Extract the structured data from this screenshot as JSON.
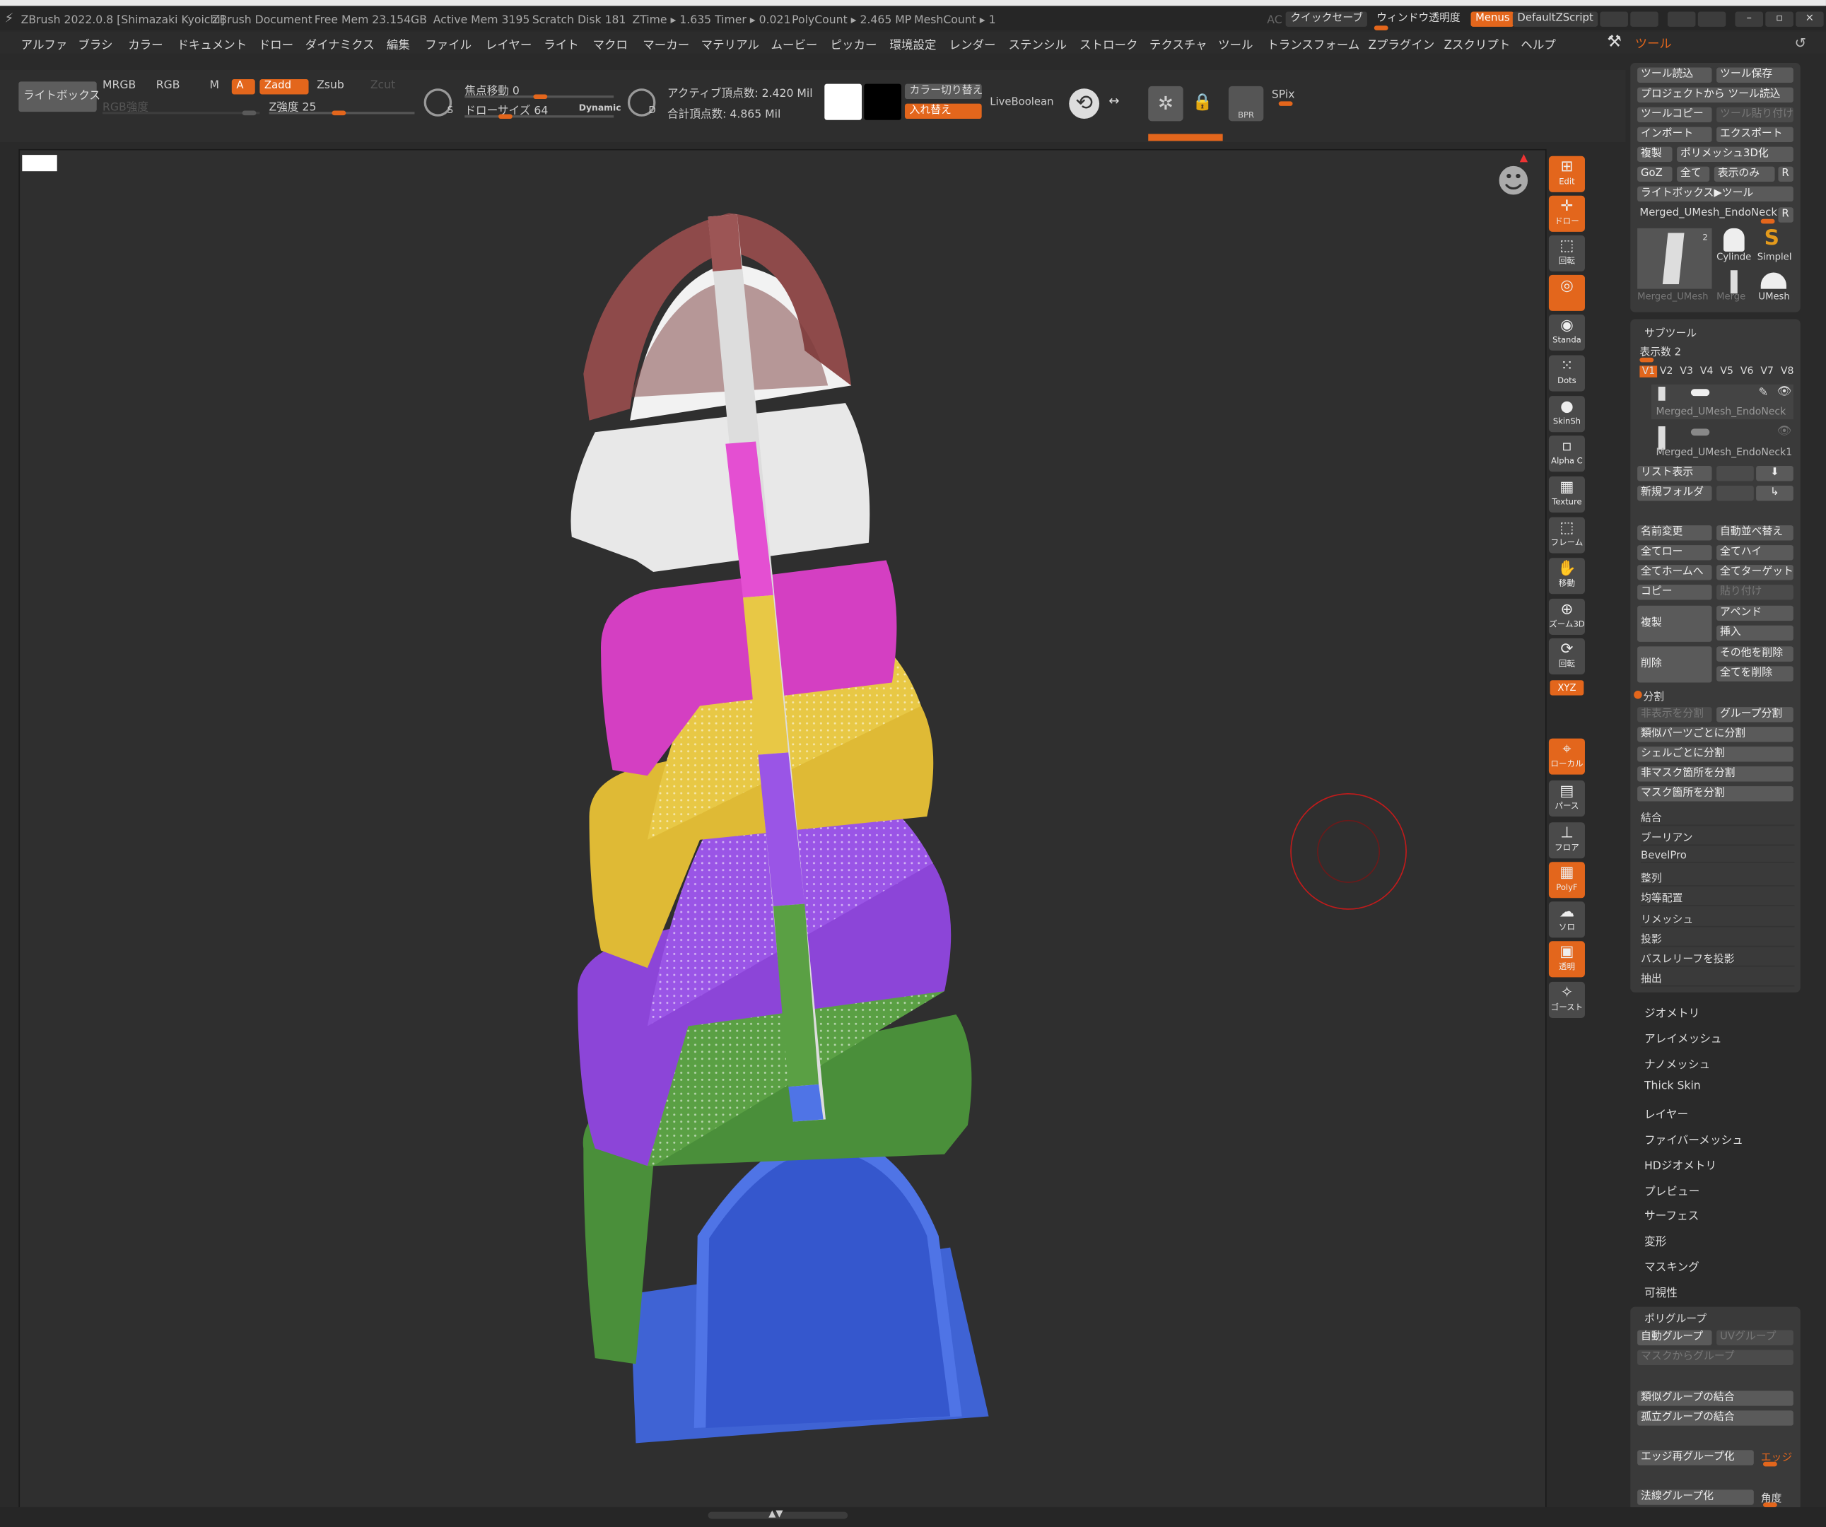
{
  "title": {
    "app": "ZBrush 2022.0.8 [Shimazaki Kyoichi]",
    "doc": "ZBrush Document",
    "free_mem": "Free Mem 23.154GB",
    "active_mem": "Active Mem 3195",
    "scratch": "Scratch Disk 181",
    "ztime": "ZTime ▸ 1.635 Timer ▸ 0.021",
    "polycount": "PolyCount ▸ 2.465 MP",
    "meshcount": "MeshCount ▸ 1",
    "ac": "AC",
    "quicksave": "クイックセーブ",
    "window_trans": "ウィンドウ透明度",
    "menus": "Menus",
    "script": "DefaultZScript"
  },
  "menu": [
    "アルファ",
    "ブラシ",
    "カラー",
    "ドキュメント",
    "ドロー",
    "ダイナミクス",
    "編集",
    "ファイル",
    "レイヤー",
    "ライト",
    "マクロ",
    "マーカー",
    "マテリアル",
    "ムービー",
    "ピッカー",
    "環境設定",
    "レンダー",
    "ステンシル",
    "ストローク",
    "テクスチャ",
    "ツール",
    "トランスフォーム",
    "Zプラグイン",
    "Zスクリプト",
    "ヘルプ"
  ],
  "tool_title": "ツール",
  "toolbar": {
    "lightbox": "ライトボックス",
    "mrgb": "MRGB",
    "rgb": "RGB",
    "m": "M",
    "a": "A",
    "zadd": "Zadd",
    "zsub": "Zsub",
    "zcut": "Zcut",
    "rgb_intensity": "RGB強度",
    "z_intensity": "Z強度 25",
    "focal": "焦点移動 0",
    "draw_size": "ドローサイズ 64",
    "dynamic": "Dynamic",
    "active_points": "アクティブ頂点数: 2.420 Mil",
    "total_points": "合計頂点数: 4.865 Mil",
    "color_switch": "カラー切り替え",
    "swap": "入れ替え",
    "liveboolean": "LiveBoolean",
    "spix": "SPix",
    "s": "S",
    "d": "D",
    "bpr": "BPR"
  },
  "shelf": [
    {
      "label": "Edit",
      "orange": true
    },
    {
      "label": "ドロー",
      "orange": true
    },
    {
      "label": "回転",
      "orange": false
    },
    {
      "label": "",
      "orange": true
    },
    {
      "label": "Standa",
      "orange": false
    },
    {
      "label": "Dots",
      "orange": false
    },
    {
      "label": "SkinSh",
      "orange": false
    },
    {
      "label": "Alpha C",
      "orange": false
    },
    {
      "label": "Texture",
      "orange": false
    },
    {
      "label": "フレーム",
      "orange": false
    },
    {
      "label": "移動",
      "orange": false
    },
    {
      "label": "ズーム3D",
      "orange": false
    },
    {
      "label": "回転",
      "orange": false
    },
    {
      "label": "ローカル",
      "orange": true
    },
    {
      "label": "パース",
      "orange": false
    },
    {
      "label": "フロア",
      "orange": false
    },
    {
      "label": "PolyF",
      "orange": true
    },
    {
      "label": "ソロ",
      "orange": false
    },
    {
      "label": "透明",
      "orange": true
    },
    {
      "label": "ゴースト",
      "orange": false
    }
  ],
  "shelf_xyz": "XYZ",
  "tool_panel": {
    "load": "ツール読込",
    "save": "ツール保存",
    "from_project": "プロジェクトから ツール読込",
    "copy_tool": "ツールコピー",
    "paste_tool": "ツール貼り付け",
    "import": "インポート",
    "export": "エクスポート",
    "clone": "複製",
    "make_polymesh": "ポリメッシュ3D化",
    "goz": "GoZ",
    "all": "全て",
    "visible": "表示のみ",
    "r": "R",
    "lightbox_tool": "ライトボックス▶ツール",
    "current": "Merged_UMesh_EndoNeck",
    "thumbs": [
      "Cylinde",
      "SimpleI",
      "Merged_UMesh",
      "Merge",
      "UMesh"
    ],
    "thumb_num": "2"
  },
  "subtool": {
    "title": "サブツール",
    "count": "表示数 2",
    "versions": [
      "V1",
      "V2",
      "V3",
      "V4",
      "V5",
      "V6",
      "V7",
      "V8"
    ],
    "items": [
      "Merged_UMesh_EndoNeck",
      "Merged_UMesh_EndoNeck1"
    ],
    "list": "リスト表示",
    "new_folder": "新規フォルダ",
    "rename": "名前変更",
    "auto_sort": "自動並べ替え",
    "all_low": "全てロー",
    "all_high": "全てハイ",
    "all_home": "全てホームへ",
    "all_target": "全てターゲット",
    "copy": "コピー",
    "paste": "貼り付け",
    "duplicate": "複製",
    "append": "アペンド",
    "insert": "挿入",
    "delete": "削除",
    "del_other": "その他を削除",
    "del_all": "全てを削除",
    "split": "分割",
    "split_hidden": "非表示を分割",
    "group_split": "グループ分割",
    "split_parts": "類似パーツごとに分割",
    "split_shell": "シェルごとに分割",
    "split_unmasked": "非マスク箇所を分割",
    "split_masked": "マスク箇所を分割",
    "sections": [
      "結合",
      "ブーリアン",
      "BevelPro",
      "整列",
      "均等配置",
      "リメッシュ",
      "投影",
      "バスレリーフを投影",
      "抽出"
    ]
  },
  "tool_sections": [
    "ジオメトリ",
    "アレイメッシュ",
    "ナノメッシュ",
    "Thick Skin",
    "レイヤー",
    "ファイバーメッシュ",
    "HDジオメトリ",
    "プレビュー",
    "サーフェス",
    "変形",
    "マスキング",
    "可視性"
  ],
  "polygroup": {
    "title": "ポリグループ",
    "auto": "自動グループ",
    "uv_groups": "UVグループ",
    "from_mask": "マスクからグループ",
    "merge_similar": "類似グループの結合",
    "merge_stray": "孤立グループの結合",
    "edge_regroup": "エッジ再グループ化",
    "edge": "エッジ",
    "normal_group": "法線グループ化",
    "angle": "角度"
  }
}
